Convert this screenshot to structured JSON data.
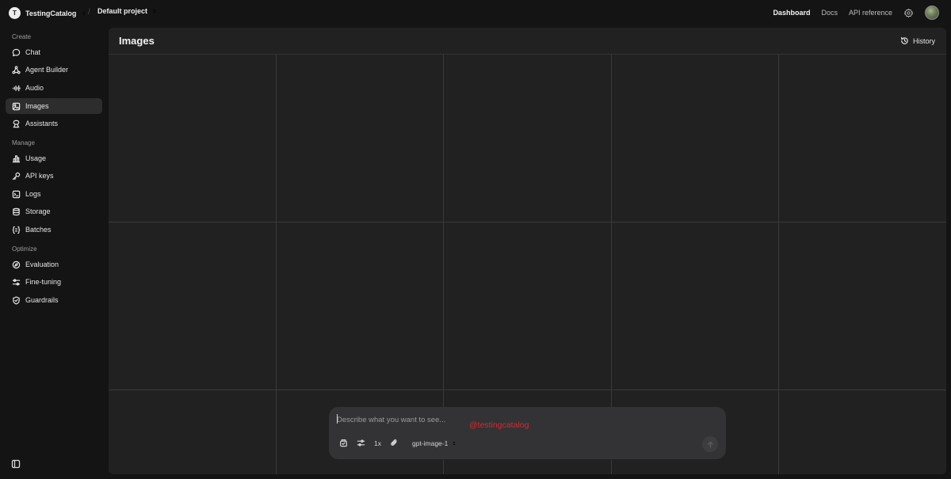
{
  "topbar": {
    "org_initial": "T",
    "org_name": "TestingCatalog",
    "separator": "/",
    "project_name": "Default project",
    "nav": {
      "dashboard": "Dashboard",
      "docs": "Docs",
      "api_reference": "API reference"
    },
    "settings_icon": "gear-icon",
    "user_avatar": "user-avatar"
  },
  "sidebar": {
    "sections": {
      "create": "Create",
      "manage": "Manage",
      "optimize": "Optimize"
    },
    "items": [
      {
        "label": "Chat",
        "icon": "chat-bubble-icon"
      },
      {
        "label": "Agent Builder",
        "icon": "nodes-icon"
      },
      {
        "label": "Audio",
        "icon": "audio-wave-icon"
      },
      {
        "label": "Images",
        "icon": "image-icon",
        "active": true
      },
      {
        "label": "Assistants",
        "icon": "assistant-icon"
      },
      {
        "label": "Usage",
        "icon": "bar-chart-icon"
      },
      {
        "label": "API keys",
        "icon": "key-icon"
      },
      {
        "label": "Logs",
        "icon": "terminal-icon"
      },
      {
        "label": "Storage",
        "icon": "database-icon"
      },
      {
        "label": "Batches",
        "icon": "batches-icon"
      },
      {
        "label": "Evaluation",
        "icon": "compass-icon"
      },
      {
        "label": "Fine-tuning",
        "icon": "sliders-icon"
      },
      {
        "label": "Guardrails",
        "icon": "shield-check-icon"
      }
    ],
    "collapse_icon": "sidebar-toggle-icon"
  },
  "main": {
    "title": "Images",
    "history_label": "History"
  },
  "composer": {
    "placeholder": "Describe what you want to see...",
    "count_label": "1x",
    "model": "gpt-image-1",
    "watermark": "@testingcatalog"
  },
  "colors": {
    "background": "#141414",
    "panel": "#212121",
    "composer": "#333335",
    "active_nav": "#2d2d2d",
    "watermark": "#d9272e"
  }
}
